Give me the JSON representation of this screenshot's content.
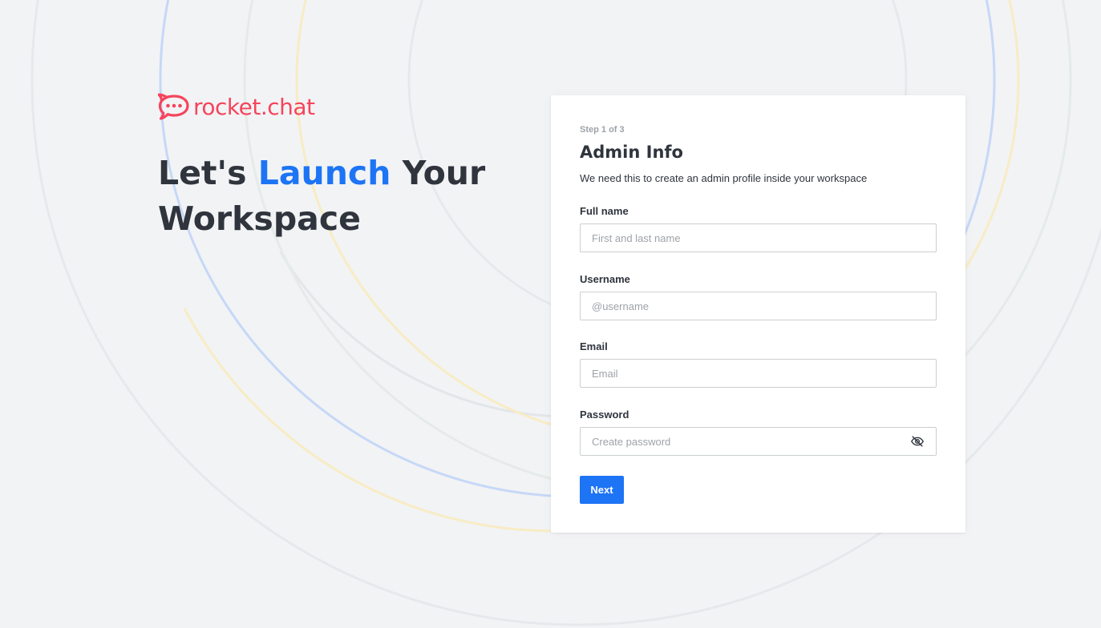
{
  "brand": {
    "name": "rocket.chat",
    "color": "#f5455c"
  },
  "headline": {
    "part1": "Let's ",
    "accent": "Launch",
    "part2": " Your Workspace",
    "accent_color": "#1d74f5"
  },
  "form": {
    "step": "Step 1 of 3",
    "title": "Admin Info",
    "subtitle": "We need this to create an admin profile inside your workspace",
    "fields": {
      "fullname": {
        "label": "Full name",
        "placeholder": "First and last name",
        "value": ""
      },
      "username": {
        "label": "Username",
        "placeholder": "@username",
        "value": ""
      },
      "email": {
        "label": "Email",
        "placeholder": "Email",
        "value": ""
      },
      "password": {
        "label": "Password",
        "placeholder": "Create password",
        "value": "",
        "toggle_icon": "eye-off-icon"
      }
    },
    "next_label": "Next",
    "primary_color": "#1d74f5"
  }
}
